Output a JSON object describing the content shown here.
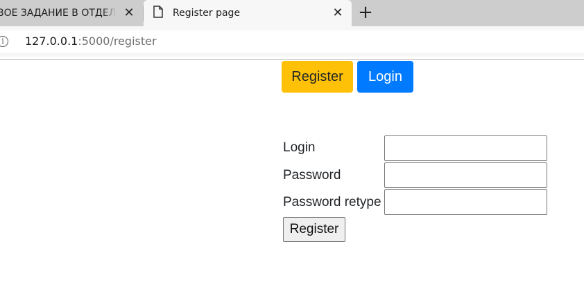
{
  "browser": {
    "tabs": [
      {
        "title": "ВОЕ ЗАДАНИЕ В ОТДЕЛ Р",
        "active": false
      },
      {
        "title": "Register page",
        "active": true
      }
    ],
    "close_glyph": "✕",
    "new_tab_glyph": "+",
    "address": {
      "host": "127.0.0.1",
      "path": ":5000/register"
    }
  },
  "nav": {
    "register_label": "Register",
    "login_label": "Login"
  },
  "form": {
    "login_label": "Login",
    "password_label": "Password",
    "password_retype_label": "Password retype",
    "login_value": "",
    "password_value": "",
    "password_retype_value": "",
    "submit_label": "Register"
  },
  "colors": {
    "register_button": "#ffc107",
    "login_button": "#007bff"
  }
}
